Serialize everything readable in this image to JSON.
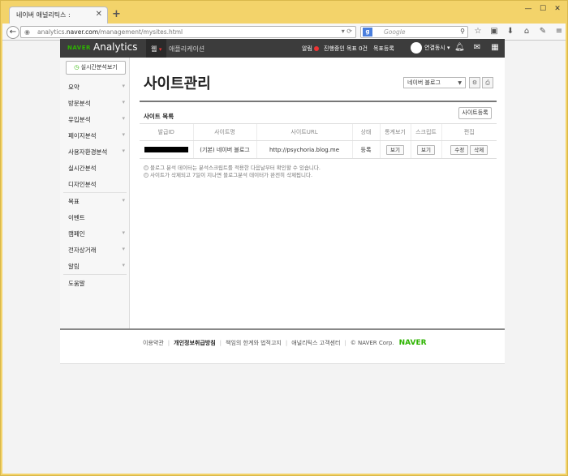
{
  "browser": {
    "tab_title": "네이버 애널리틱스 :",
    "tab_close": "✕",
    "new_tab": "+",
    "url_prefix": "analytics.",
    "url_domain": "naver.com",
    "url_path": "/management/mysites.html",
    "search_placeholder": "Google",
    "search_engine_letter": "g"
  },
  "header": {
    "naver_logo": "NAVER",
    "analytics_logo": "Analytics",
    "nav_web": "웹",
    "nav_app": "애플리케이션",
    "alert": "알림",
    "goal_progress": "진행중인 목표 0건",
    "goal_register": "목표등록",
    "user": "연결동시 ▾"
  },
  "sidebar": {
    "realtime_button": "실시간분석보기",
    "items": [
      {
        "label": "요약",
        "chevron": true
      },
      {
        "label": "방문분석",
        "chevron": true
      },
      {
        "label": "유입분석",
        "chevron": true
      },
      {
        "label": "페이지분석",
        "chevron": true
      },
      {
        "label": "사용자환경분석",
        "chevron": true
      },
      {
        "label": "실시간분석",
        "chevron": false
      },
      {
        "label": "디자인분석",
        "chevron": false
      },
      {
        "label": "목표",
        "chevron": true
      },
      {
        "label": "이벤트",
        "chevron": false
      },
      {
        "label": "캠페인",
        "chevron": true
      },
      {
        "label": "전자상거래",
        "chevron": true
      },
      {
        "label": "알림",
        "chevron": true
      },
      {
        "label": "도움말",
        "chevron": false
      }
    ]
  },
  "main": {
    "title": "사이트관리",
    "site_select": "네이버 블로그",
    "section_title": "사이트 목록",
    "add_site": "사이트등록",
    "columns": [
      "발급ID",
      "사이트명",
      "사이트URL",
      "상태",
      "통계보기",
      "스크립트",
      "편집"
    ],
    "rows": [
      {
        "site_name": "(기본) 네이버 블로그",
        "site_url": "http://psychoria.blog.me",
        "status": "등록",
        "stats": "보기",
        "script": "보기",
        "edit": "수정",
        "delete": "삭제"
      }
    ],
    "notes": [
      "블로그 분석 데이터는 분석스크립트를 적용한 다음날부터 확인할 수 있습니다.",
      "사이트가 삭제되고 7일이 지나면 블로그분석 데이터가 완전히 삭제됩니다."
    ]
  },
  "footer": {
    "links": [
      "이용약관",
      "개인정보취급방침",
      "책임의 한계와 법적고지",
      "애널리틱스 고객센터"
    ],
    "copyright": "© NAVER Corp.",
    "brand": "NAVER"
  }
}
